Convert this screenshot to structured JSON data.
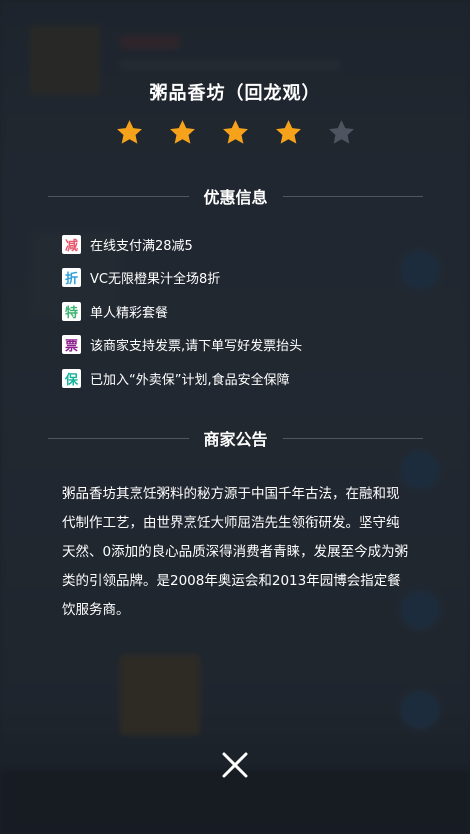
{
  "shop": {
    "name": "粥品香坊（回龙观）",
    "rating": 4,
    "max_rating": 5
  },
  "sections": {
    "discount_title": "优惠信息",
    "bulletin_title": "商家公告"
  },
  "supports": [
    {
      "badge": "减",
      "color": "#e8566c",
      "text": "在线支付满28减5"
    },
    {
      "badge": "折",
      "color": "#2e9fd8",
      "text": "VC无限橙果汁全场8折"
    },
    {
      "badge": "特",
      "color": "#3cb371",
      "text": "单人精彩套餐"
    },
    {
      "badge": "票",
      "color": "#8b1f8f",
      "text": "该商家支持发票,请下单写好发票抬头"
    },
    {
      "badge": "保",
      "color": "#17b39c",
      "text": "已加入“外卖保”计划,食品安全保障"
    }
  ],
  "bulletin": "粥品香坊其烹饪粥料的秘方源于中国千年古法，在融和现代制作工艺，由世界烹饪大师屈浩先生领衔研发。坚守纯天然、0添加的良心品质深得消费者青睐，发展至今成为粥类的引领品牌。是2008年奥运会和2013年园博会指定餐饮服务商。",
  "colors": {
    "star_on": "#f7a21b",
    "star_off": "#4d5561"
  },
  "icons": {
    "star": "star-icon",
    "close": "close-icon"
  }
}
